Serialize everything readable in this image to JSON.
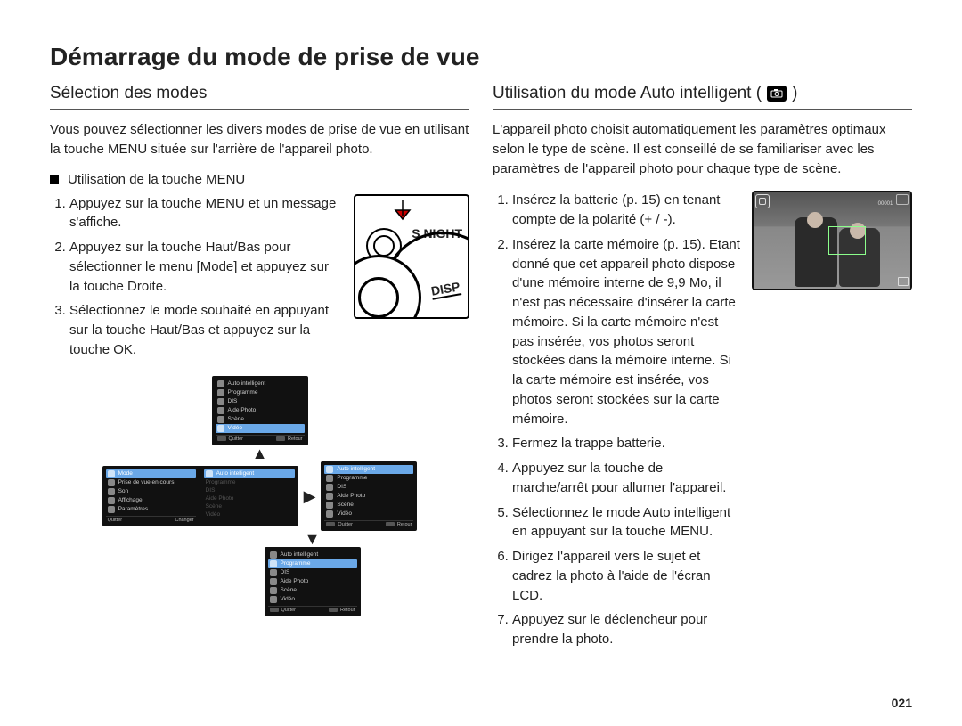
{
  "title": "Démarrage du mode de prise de vue",
  "page_number": "021",
  "left": {
    "heading": "Sélection des modes",
    "intro": "Vous pouvez sélectionner les divers modes de prise de vue en utilisant la touche MENU située sur l'arrière de l'appareil photo.",
    "subhead": "Utilisation de la touche MENU",
    "steps": [
      "Appuyez sur la touche MENU et un message s'affiche.",
      "Appuyez sur la touche Haut/Bas pour sélectionner le menu [Mode] et appuyez sur la touche Droite.",
      "Sélectionnez le mode souhaité en appuyant sur la touche Haut/Bas et appuyez sur la touche OK."
    ],
    "diagram": {
      "label_snight": "S.NIGHT",
      "label_disp": "DISP"
    },
    "screens": {
      "menuA": {
        "items": [
          {
            "label": "Auto intelligent"
          },
          {
            "label": "Programme"
          },
          {
            "label": "DIS"
          },
          {
            "label": "Aide Photo"
          },
          {
            "label": "Scène"
          },
          {
            "label": "Vidéo",
            "highlight": true
          }
        ],
        "footer_left": "Quitter",
        "footer_right": "Retour"
      },
      "modeMenu": {
        "left_items": [
          {
            "label": "Mode",
            "selected": true
          },
          {
            "label": "Prise de vue en cours"
          },
          {
            "label": "Son"
          },
          {
            "label": "Affichage"
          },
          {
            "label": "Paramètres"
          }
        ],
        "right_items": [
          {
            "label": "Auto intelligent",
            "selected": true
          },
          {
            "label": "Programme",
            "dim": true
          },
          {
            "label": "DIS",
            "dim": true
          },
          {
            "label": "Aide Photo",
            "dim": true
          },
          {
            "label": "Scène",
            "dim": true
          },
          {
            "label": "Vidéo",
            "dim": true
          }
        ],
        "footer_left": "Quitter",
        "footer_right": "Changer"
      },
      "menuB": {
        "items": [
          {
            "label": "Auto intelligent",
            "highlight": true
          },
          {
            "label": "Programme"
          },
          {
            "label": "DIS"
          },
          {
            "label": "Aide Photo"
          },
          {
            "label": "Scène"
          },
          {
            "label": "Vidéo"
          }
        ],
        "footer_left": "Quitter",
        "footer_right": "Retour"
      },
      "menuC": {
        "items": [
          {
            "label": "Auto intelligent"
          },
          {
            "label": "Programme",
            "highlight": true
          },
          {
            "label": "DIS"
          },
          {
            "label": "Aide Photo"
          },
          {
            "label": "Scène"
          },
          {
            "label": "Vidéo"
          }
        ],
        "footer_left": "Quitter",
        "footer_right": "Retour"
      }
    }
  },
  "right": {
    "heading_pre": "Utilisation du mode Auto intelligent ( ",
    "heading_post": " )",
    "intro": "L'appareil photo choisit automatiquement les paramètres optimaux selon le type de scène. Il est conseillé de se familiariser avec les paramètres de l'appareil photo pour chaque type de scène.",
    "steps": [
      "Insérez la batterie (p. 15) en tenant compte de la polarité (+ / -).",
      "Insérez la carte mémoire (p. 15). Etant donné que cet appareil photo dispose d'une mémoire interne de 9,9 Mo, il n'est pas nécessaire d'insérer la carte mémoire. Si la carte mémoire n'est pas insérée, vos photos seront stockées dans la mémoire interne. Si la carte mémoire est insérée, vos photos seront stockées sur la carte mémoire.",
      "Fermez la trappe batterie.",
      "Appuyez sur la touche de marche/arrêt pour allumer l'appareil.",
      "Sélectionnez le mode Auto intelligent en appuyant sur la touche MENU.",
      "Dirigez l'appareil vers le sujet et cadrez la photo à l'aide de l'écran LCD.",
      "Appuyez sur le déclencheur pour prendre la photo."
    ],
    "lcd": {
      "counter": "00001"
    }
  }
}
